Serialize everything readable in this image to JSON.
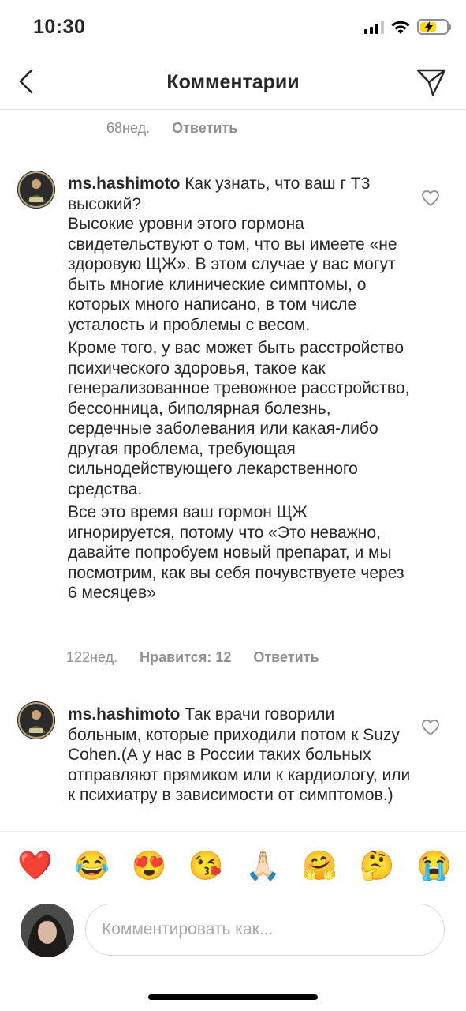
{
  "status_bar": {
    "time": "10:30"
  },
  "header": {
    "title": "Комментарии"
  },
  "previous_comment": {
    "time": "68нед.",
    "reply_label": "Ответить"
  },
  "comments": [
    {
      "username": "ms.hashimoto",
      "text_first": "Как узнать, что ваш г Т3 высокий?",
      "paragraphs": [
        "Высокие уровни этого гормона свидетельствуют о том, что вы имеете «не здоровую ЩЖ». В этом случае у вас могут быть многие клинические симптомы, о которых много написано, в том числе усталость и проблемы с весом.",
        "Кроме того, у вас может быть расстройство психического здоровья, такое как генерализованное тревожное расстройство, бессонница, биполярная болезнь, сердечные заболевания или какая-либо другая проблема, требующая сильнодействующего лекарственного средства.",
        "Все это время ваш гормон ЩЖ игнорируется, потому что «Это неважно, давайте попробуем новый препарат, и мы посмотрим, как вы себя почувствуете через 6 месяцев»"
      ],
      "time": "122нед.",
      "likes_label": "Нравится: 12",
      "reply_label": "Ответить"
    },
    {
      "username": "ms.hashimoto",
      "text_first": "Так врачи говорили больным, которые приходили потом к Suzy Cohen.(А у нас в России таких больных отправляют прямиком или к кардиологу, или к психиатру в зависимости от симптомов.)"
    }
  ],
  "emoji_bar": [
    "❤️",
    "😂",
    "😍",
    "😘",
    "🙏🏻",
    "🤗",
    "🤔",
    "😭"
  ],
  "composer": {
    "placeholder": "Комментировать как..."
  },
  "colors": {
    "text": "#262626",
    "secondary": "#8e8e93",
    "border": "#dbdbdb",
    "battery": "#ffd60a"
  }
}
